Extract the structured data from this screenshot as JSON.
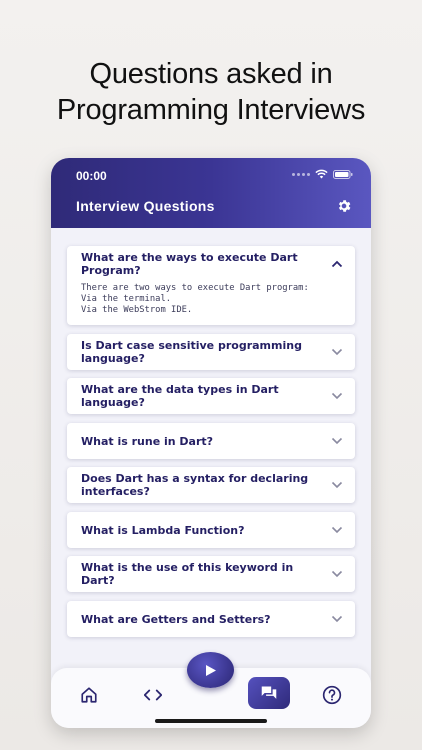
{
  "headline": {
    "line1": "Questions asked in",
    "line2": "Programming Interviews"
  },
  "status_bar": {
    "time": "00:00"
  },
  "app_bar": {
    "title": "Interview Questions",
    "settings_icon": "gear-icon"
  },
  "questions": [
    {
      "question": "What are the ways to execute Dart Program?",
      "expanded": true,
      "answer_lines": [
        "There are two ways to execute Dart program:",
        "Via the terminal.",
        "Via the WebStrom IDE."
      ]
    },
    {
      "question": "Is Dart case sensitive programming language?",
      "expanded": false
    },
    {
      "question": "What are the data types in Dart language?",
      "expanded": false
    },
    {
      "question": "What is rune in Dart?",
      "expanded": false
    },
    {
      "question": "Does Dart has a syntax for declaring interfaces?",
      "expanded": false
    },
    {
      "question": "What is Lambda Function?",
      "expanded": false
    },
    {
      "question": "What is the use of this keyword in Dart?",
      "expanded": false
    },
    {
      "question": "What are Getters and Setters?",
      "expanded": false
    }
  ],
  "bottom_nav": {
    "items": [
      "home-icon",
      "code-icon",
      "play-icon",
      "chat-icon",
      "help-icon"
    ],
    "active": "chat-icon"
  },
  "colors": {
    "primary": "#2f2a78",
    "accent": "#5a57c0",
    "question_text": "#241f63"
  }
}
